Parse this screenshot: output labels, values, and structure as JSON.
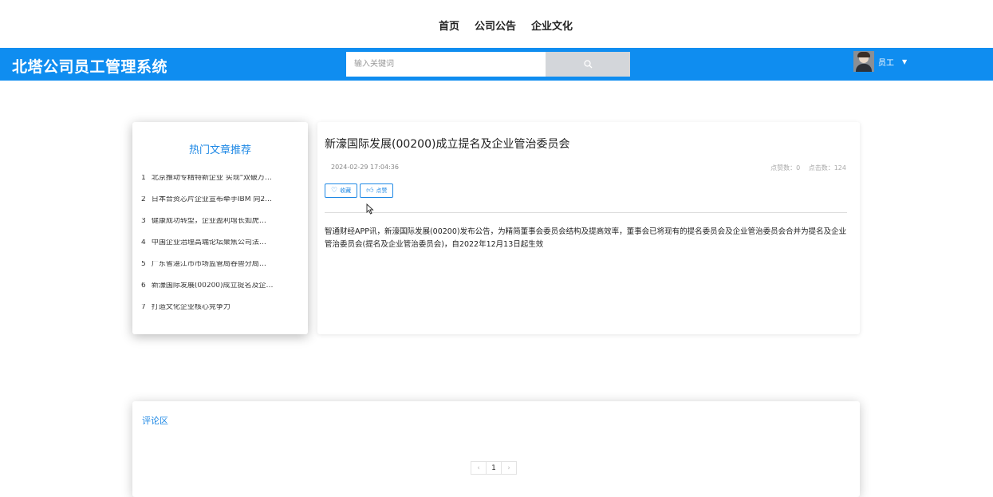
{
  "topnav": {
    "links": [
      "首页",
      "公司公告",
      "企业文化"
    ]
  },
  "header": {
    "brand": "北塔公司员工管理系统",
    "search_placeholder": "输入关键词",
    "search_icon": "search-icon",
    "user_name": "员工",
    "caret_icon": "caret-down-icon",
    "bg_color": "#0f8df0"
  },
  "hot": {
    "title": "热门文章推荐",
    "items": [
      {
        "num": "1",
        "text": "北京推动专精特新企业 实现\"双破万…"
      },
      {
        "num": "2",
        "text": "日本合资芯片企业宣布牵手IBM 向2…"
      },
      {
        "num": "3",
        "text": "健康成功转型，企业盈利增长如虎…"
      },
      {
        "num": "4",
        "text": "中国企业治理高端论坛聚焦公司法…"
      },
      {
        "num": "5",
        "text": "广东省湛江市市场监管局吞兽分局…"
      },
      {
        "num": "6",
        "text": "新濠国际发展(00200)成立提名及企…"
      },
      {
        "num": "7",
        "text": "打造文化企业核心竞争力"
      }
    ]
  },
  "article": {
    "title": "新濠国际发展(00200)成立提名及企业管治委员会",
    "date": "2024-02-29 17:04:36",
    "likes": "点赞数：0",
    "views": "点击数：124",
    "favorite_label": "收藏",
    "like_label": "点赞",
    "content": "智通财经APP讯，新濠国际发展(00200)发布公告，为精简董事会委员会结构及提高效率，董事会已将现有的提名委员会及企业管治委员会合并为提名及企业管治委员会(提名及企业管治委员会)，自2022年12月13日起生效"
  },
  "comments": {
    "label": "评论区",
    "pager": {
      "prev": "‹",
      "page": "1",
      "next": "›"
    }
  },
  "colors": {
    "accent": "#1e88e5",
    "header_blue": "#0f8df0"
  }
}
